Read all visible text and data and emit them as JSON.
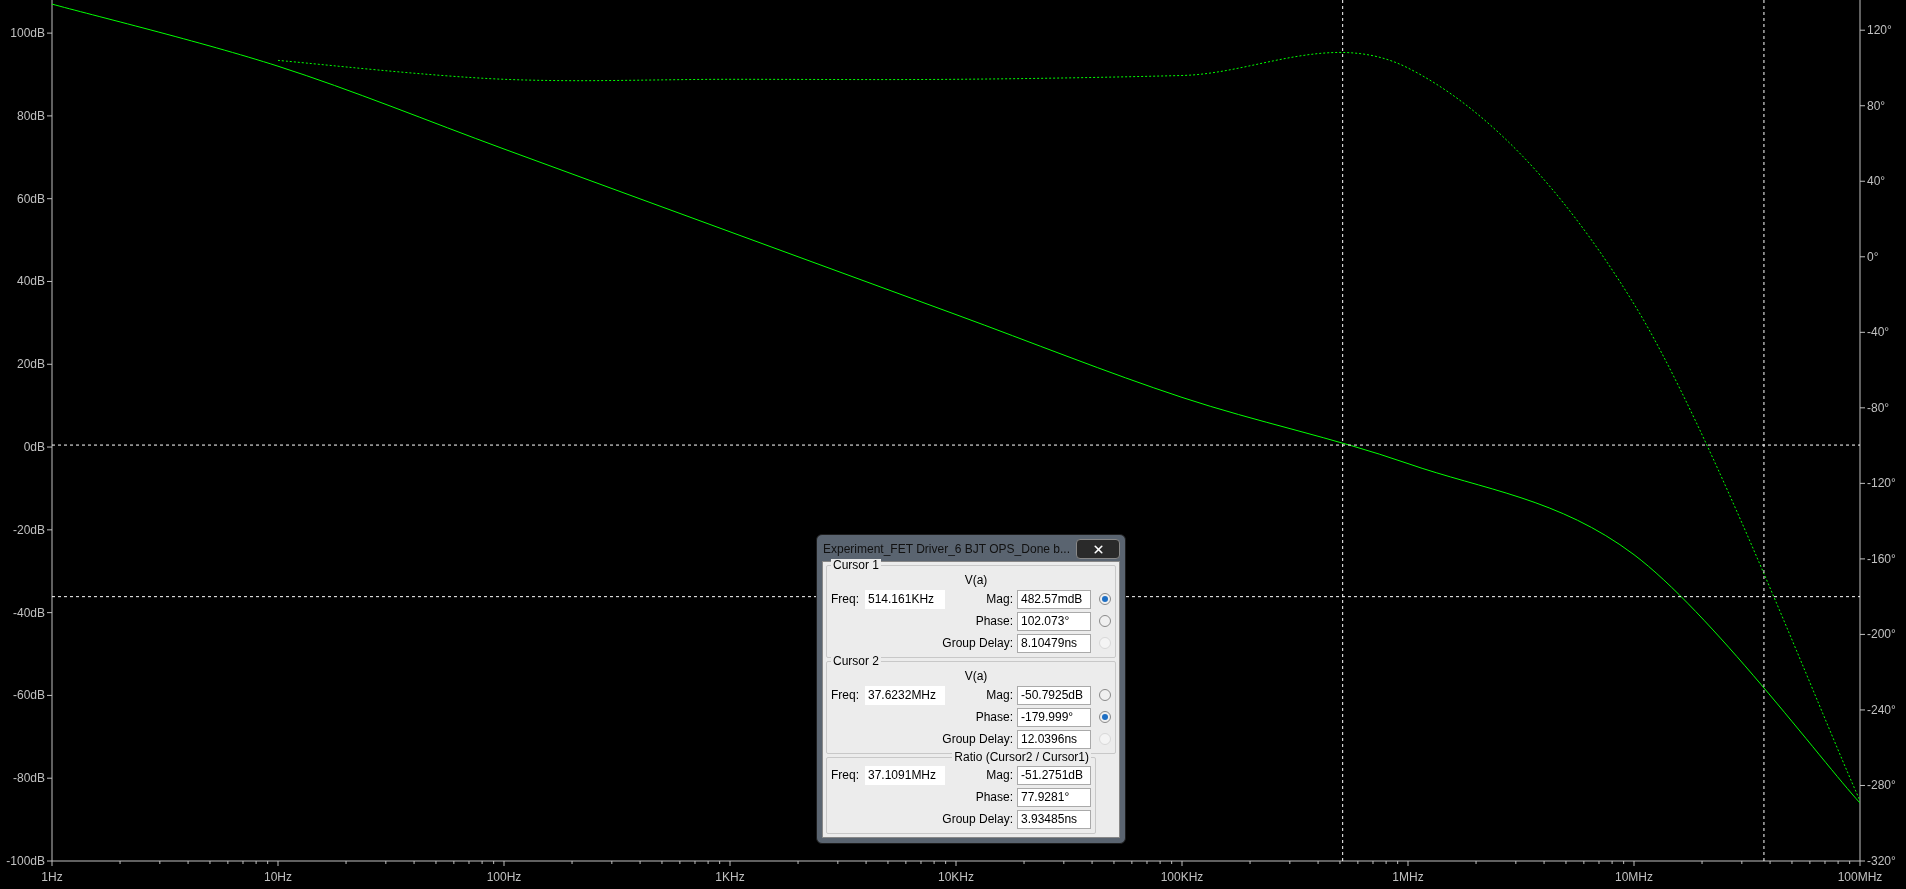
{
  "chart_data": {
    "type": "line",
    "categories": [
      "1Hz",
      "10Hz",
      "100Hz",
      "1KHz",
      "10KHz",
      "100KHz",
      "1MHz",
      "10MHz",
      "100MHz"
    ],
    "series": [
      {
        "color": "#00ff00",
        "line_style": "solid",
        "values": [
          107,
          92,
          72,
          52,
          32,
          12,
          -4,
          -26,
          -86
        ]
      },
      {
        "color": "#00ff00",
        "axis": "y2",
        "line_style": "dashed",
        "values": [
          null,
          104,
          94,
          94,
          94,
          96,
          100,
          -25,
          -288
        ]
      }
    ],
    "ylim": [
      -100,
      108
    ],
    "y2lim": [
      -320,
      136
    ],
    "yticks": [
      {
        "value": 100,
        "label": "100dB"
      },
      {
        "value": 80,
        "label": "80dB"
      },
      {
        "value": 60,
        "label": "60dB"
      },
      {
        "value": 40,
        "label": "40dB"
      },
      {
        "value": 20,
        "label": "20dB"
      },
      {
        "value": 0,
        "label": "0dB"
      },
      {
        "value": -20,
        "label": "-20dB"
      },
      {
        "value": -40,
        "label": "-40dB"
      },
      {
        "value": -60,
        "label": "-60dB"
      },
      {
        "value": -80,
        "label": "-80dB"
      },
      {
        "value": -100,
        "label": "-100dB"
      }
    ],
    "y2ticks": [
      {
        "value": 120,
        "label": "120°"
      },
      {
        "value": 80,
        "label": "80°"
      },
      {
        "value": 40,
        "label": "40°"
      },
      {
        "value": 0,
        "label": "0°"
      },
      {
        "value": -40,
        "label": "-40°"
      },
      {
        "value": -80,
        "label": "-80°"
      },
      {
        "value": -120,
        "label": "-120°"
      },
      {
        "value": -160,
        "label": "-160°"
      },
      {
        "value": -200,
        "label": "-200°"
      },
      {
        "value": -240,
        "label": "-240°"
      },
      {
        "value": -280,
        "label": "-280°"
      },
      {
        "value": -320,
        "label": "-320°"
      }
    ],
    "ref_lines": [
      {
        "axis": "y",
        "value": 0.48
      },
      {
        "axis": "y2",
        "value": -180
      }
    ]
  },
  "dialog": {
    "title": "Experiment_FET Driver_6 BJT OPS_Done b...",
    "sections": [
      {
        "kind": "cursor",
        "title": "Cursor 1",
        "trace": "V(a)",
        "freq_label": "Freq:",
        "freq": "514.161KHz",
        "rows": [
          {
            "label": "Mag:",
            "value": "482.57mdB",
            "selected": true,
            "disabled": false
          },
          {
            "label": "Phase:",
            "value": "102.073°",
            "selected": false,
            "disabled": false
          },
          {
            "label": "Group Delay:",
            "value": "8.10479ns",
            "selected": false,
            "disabled": true
          }
        ]
      },
      {
        "kind": "cursor",
        "title": "Cursor 2",
        "trace": "V(a)",
        "freq_label": "Freq:",
        "freq": "37.6232MHz",
        "rows": [
          {
            "label": "Mag:",
            "value": "-50.7925dB",
            "selected": false,
            "disabled": false
          },
          {
            "label": "Phase:",
            "value": "-179.999°",
            "selected": true,
            "disabled": false
          },
          {
            "label": "Group Delay:",
            "value": "12.0396ns",
            "selected": false,
            "disabled": true
          }
        ]
      },
      {
        "kind": "ratio",
        "title": "Ratio (Cursor2 / Cursor1)",
        "freq_label": "Freq:",
        "freq": "37.1091MHz",
        "rows": [
          {
            "label": "Mag:",
            "value": "-51.2751dB"
          },
          {
            "label": "Phase:",
            "value": "77.9281°"
          },
          {
            "label": "Group Delay:",
            "value": "3.93485ns"
          }
        ]
      }
    ]
  }
}
